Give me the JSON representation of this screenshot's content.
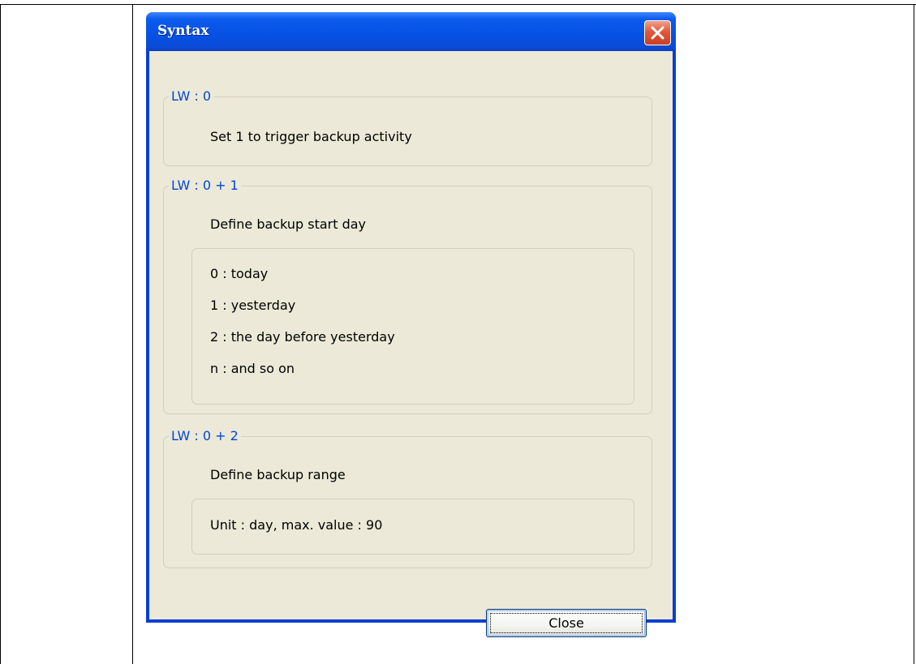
{
  "window": {
    "title": "Syntax"
  },
  "groups": [
    {
      "legend": "LW : 0",
      "description": "Set 1 to trigger backup activity"
    },
    {
      "legend": "LW : 0 + 1",
      "description": "Define backup start day",
      "options": [
        "0 : today",
        "1 : yesterday",
        "2 : the day before yesterday",
        "n : and so on"
      ]
    },
    {
      "legend": "LW : 0 + 2",
      "description": "Define backup range",
      "note": "Unit : day, max. value : 90"
    }
  ],
  "buttons": {
    "close_label": "Close"
  },
  "colors": {
    "title_bar": "#0651e3",
    "client_bg": "#ece9d8",
    "legend_text": "#0046d5",
    "close_button": "#e0593a"
  },
  "icons": {
    "close": "close-x-icon"
  }
}
